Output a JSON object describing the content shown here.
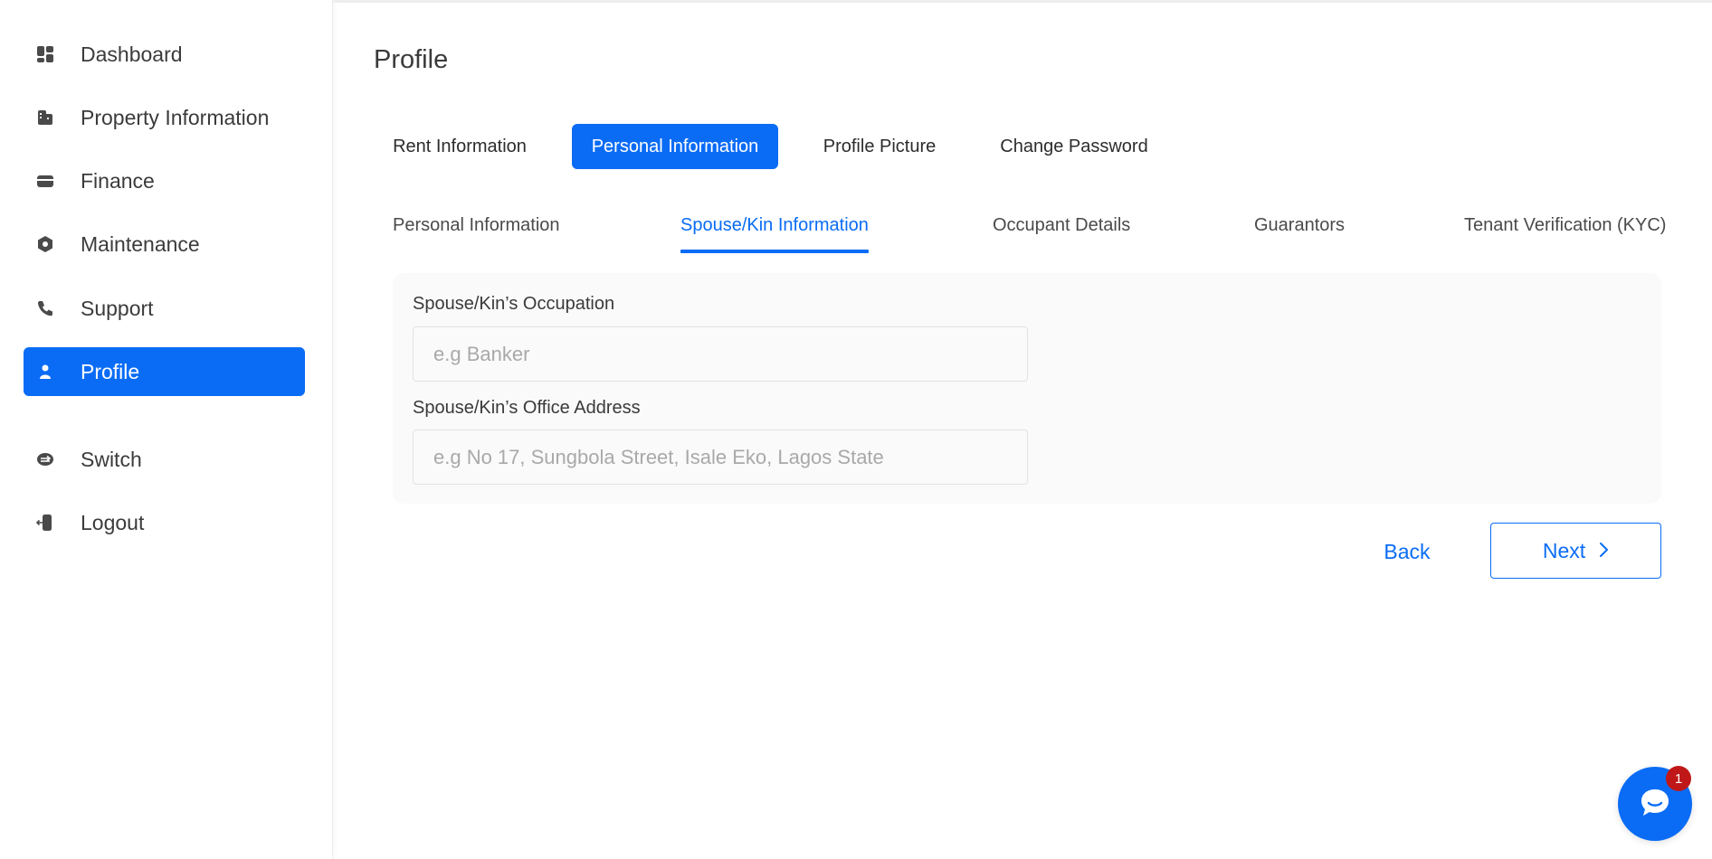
{
  "sidebar": {
    "items": [
      {
        "label": "Dashboard",
        "icon": "dashboard-icon"
      },
      {
        "label": "Property Information",
        "icon": "building-icon"
      },
      {
        "label": "Finance",
        "icon": "wallet-icon"
      },
      {
        "label": "Maintenance",
        "icon": "wrench-icon"
      },
      {
        "label": "Support",
        "icon": "phone-icon"
      },
      {
        "label": "Profile",
        "icon": "user-icon",
        "active": true
      },
      {
        "label": "Switch",
        "icon": "switch-icon"
      },
      {
        "label": "Logout",
        "icon": "logout-icon"
      }
    ]
  },
  "page": {
    "title": "Profile"
  },
  "tabs": [
    {
      "label": "Rent Information"
    },
    {
      "label": "Personal Information",
      "active": true
    },
    {
      "label": "Profile Picture"
    },
    {
      "label": "Change Password"
    }
  ],
  "subtabs": [
    {
      "label": "Personal Information"
    },
    {
      "label": "Spouse/Kin Information",
      "active": true
    },
    {
      "label": "Occupant Details"
    },
    {
      "label": "Guarantors"
    },
    {
      "label": "Tenant Verification (KYC)"
    }
  ],
  "form": {
    "occupation": {
      "label": "Spouse/Kin’s Occupation",
      "placeholder": "e.g Banker",
      "value": ""
    },
    "office_address": {
      "label": "Spouse/Kin’s Office Address",
      "placeholder": "e.g No 17, Sungbola Street, Isale Eko, Lagos State",
      "value": ""
    }
  },
  "actions": {
    "back_label": "Back",
    "next_label": "Next"
  },
  "chat": {
    "badge_count": "1"
  },
  "colors": {
    "accent": "#0a6cf5",
    "badge": "#c01818",
    "text": "#3a3a3a"
  }
}
